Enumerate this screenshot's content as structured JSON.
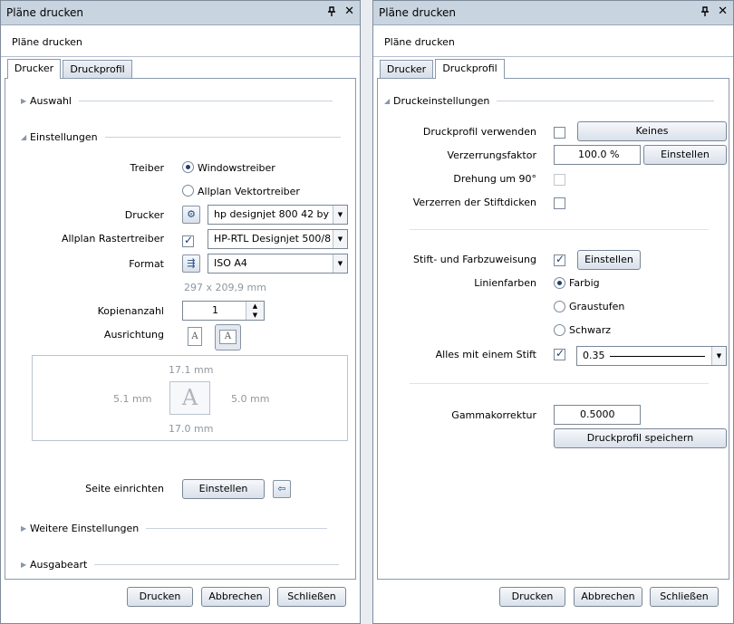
{
  "left": {
    "title": "Pläne drucken",
    "subtitle": "Pläne drucken",
    "tabs": [
      "Drucker",
      "Druckprofil"
    ],
    "sections": {
      "auswahl": "Auswahl",
      "einstellungen": "Einstellungen",
      "weitere": "Weitere Einstellungen",
      "ausgabe": "Ausgabeart"
    },
    "treiber_label": "Treiber",
    "treiber_options": [
      "Windowstreiber",
      "Allplan Vektortreiber"
    ],
    "drucker_label": "Drucker",
    "drucker_value": "hp designjet 800 42 by",
    "raster_label": "Allplan Rastertreiber",
    "raster_value": "HP-RTL Designjet 500/8",
    "format_label": "Format",
    "format_value": "ISO A4",
    "format_size": "297 x 209,9 mm",
    "kopien_label": "Kopienanzahl",
    "kopien_value": "1",
    "ausrichtung_label": "Ausrichtung",
    "margins": {
      "top": "17.1 mm",
      "left": "5.1 mm",
      "right": "5.0 mm",
      "bottom": "17.0 mm"
    },
    "page_letter": "A",
    "seite_label": "Seite einrichten",
    "seite_button": "Einstellen",
    "footer": [
      "Drucken",
      "Abbrechen",
      "Schließen"
    ]
  },
  "right": {
    "title": "Pläne drucken",
    "subtitle": "Pläne drucken",
    "tabs": [
      "Drucker",
      "Druckprofil"
    ],
    "section": "Druckeinstellungen",
    "profil_label": "Druckprofil verwenden",
    "profil_button": "Keines",
    "verz_label": "Verzerrungsfaktor",
    "verz_value": "100.0 %",
    "verz_button": "Einstellen",
    "drehung_label": "Drehung um 90°",
    "stift_dicken_label": "Verzerren der Stiftdicken",
    "stift_farb_label": "Stift- und Farbzuweisung",
    "stift_farb_button": "Einstellen",
    "linienfarben_label": "Linienfarben",
    "farben": [
      "Farbig",
      "Graustufen",
      "Schwarz"
    ],
    "alles_label": "Alles mit einem Stift",
    "alles_value": "0.35",
    "gamma_label": "Gammakorrektur",
    "gamma_value": "0.5000",
    "speichern_button": "Druckprofil speichern",
    "footer": [
      "Drucken",
      "Abbrechen",
      "Schließen"
    ]
  }
}
